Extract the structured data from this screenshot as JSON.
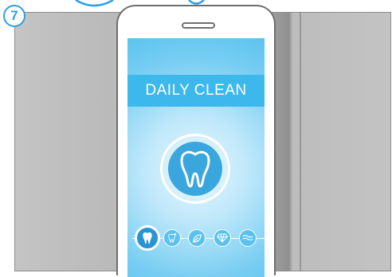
{
  "step": {
    "number": "7"
  },
  "screen": {
    "title": "DAILY CLEAN",
    "main_icon": "tooth-icon",
    "modes": [
      {
        "name": "daily-clean",
        "icon": "tooth-icon",
        "active": true
      },
      {
        "name": "whitening",
        "icon": "tooth-sparkle-icon",
        "active": false
      },
      {
        "name": "gum-care",
        "icon": "leaf-icon",
        "active": false
      },
      {
        "name": "polish",
        "icon": "diamond-icon",
        "active": false
      },
      {
        "name": "sensitive",
        "icon": "wave-icon",
        "active": false
      }
    ]
  },
  "colors": {
    "accent": "#2ea0df",
    "screen_blue": "#3cb8ec",
    "panel_gray": "#bbbbbb"
  }
}
